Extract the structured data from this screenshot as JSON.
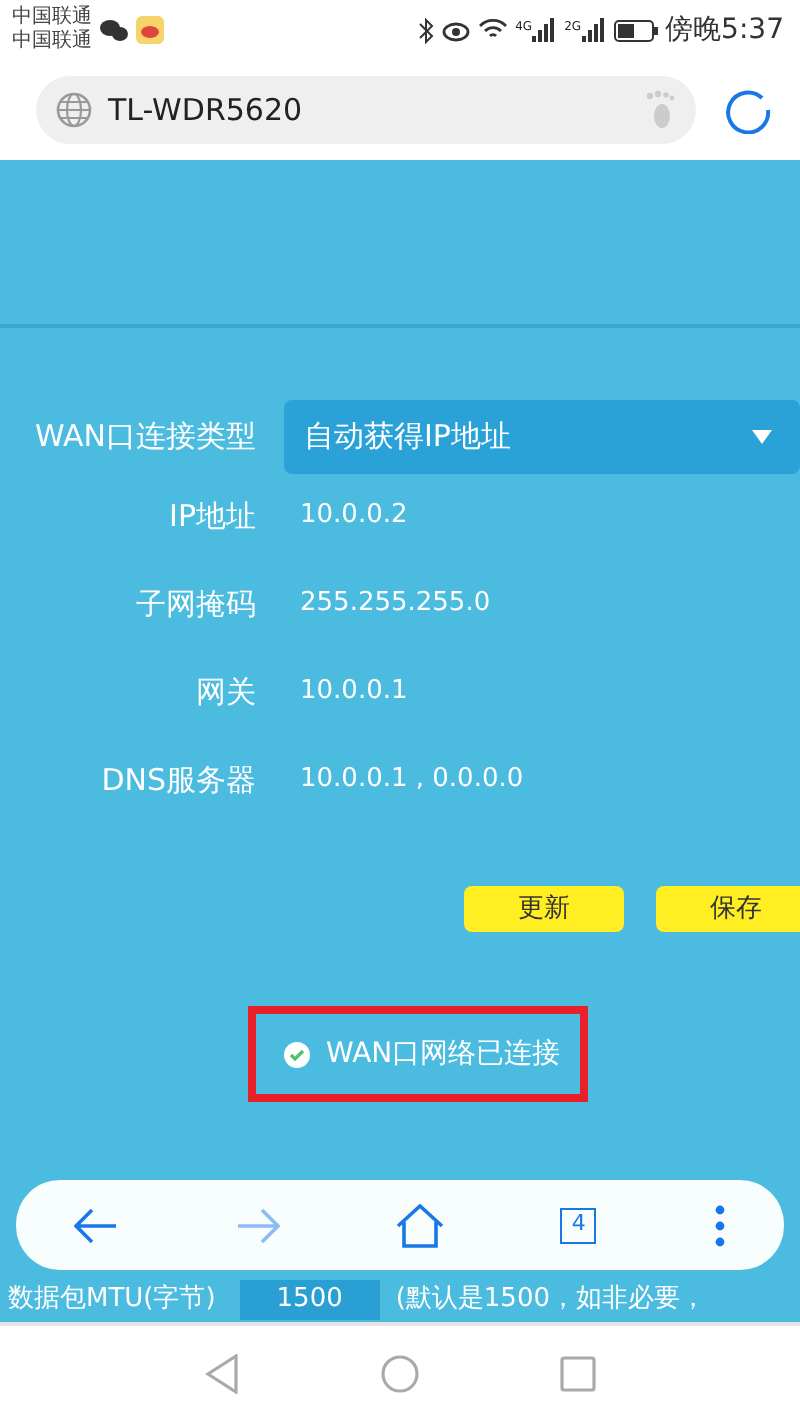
{
  "status_bar": {
    "carriers": [
      "中国联通",
      "中国联通"
    ],
    "time": "傍晚5:37",
    "signal_labels": [
      "4G",
      "2G"
    ]
  },
  "address_bar": {
    "url": "TL-WDR5620"
  },
  "form": {
    "connection_type": {
      "label": "WAN口连接类型",
      "value": "自动获得IP地址"
    },
    "fields": [
      {
        "label": "IP地址",
        "value": "10.0.0.2"
      },
      {
        "label": "子网掩码",
        "value": "255.255.255.0"
      },
      {
        "label": "网关",
        "value": "10.0.0.1"
      },
      {
        "label": "DNS服务器",
        "value": "10.0.0.1 , 0.0.0.0"
      }
    ],
    "buttons": [
      "更新",
      "保存"
    ],
    "connection_status": {
      "text": "WAN口网络已连接",
      "connected": true
    },
    "mtu": {
      "label": "数据包MTU(字节)",
      "value": "1500",
      "hint": "(默认是1500，如非必要，"
    }
  },
  "browser_toolbar": {
    "tab_count": "4"
  }
}
